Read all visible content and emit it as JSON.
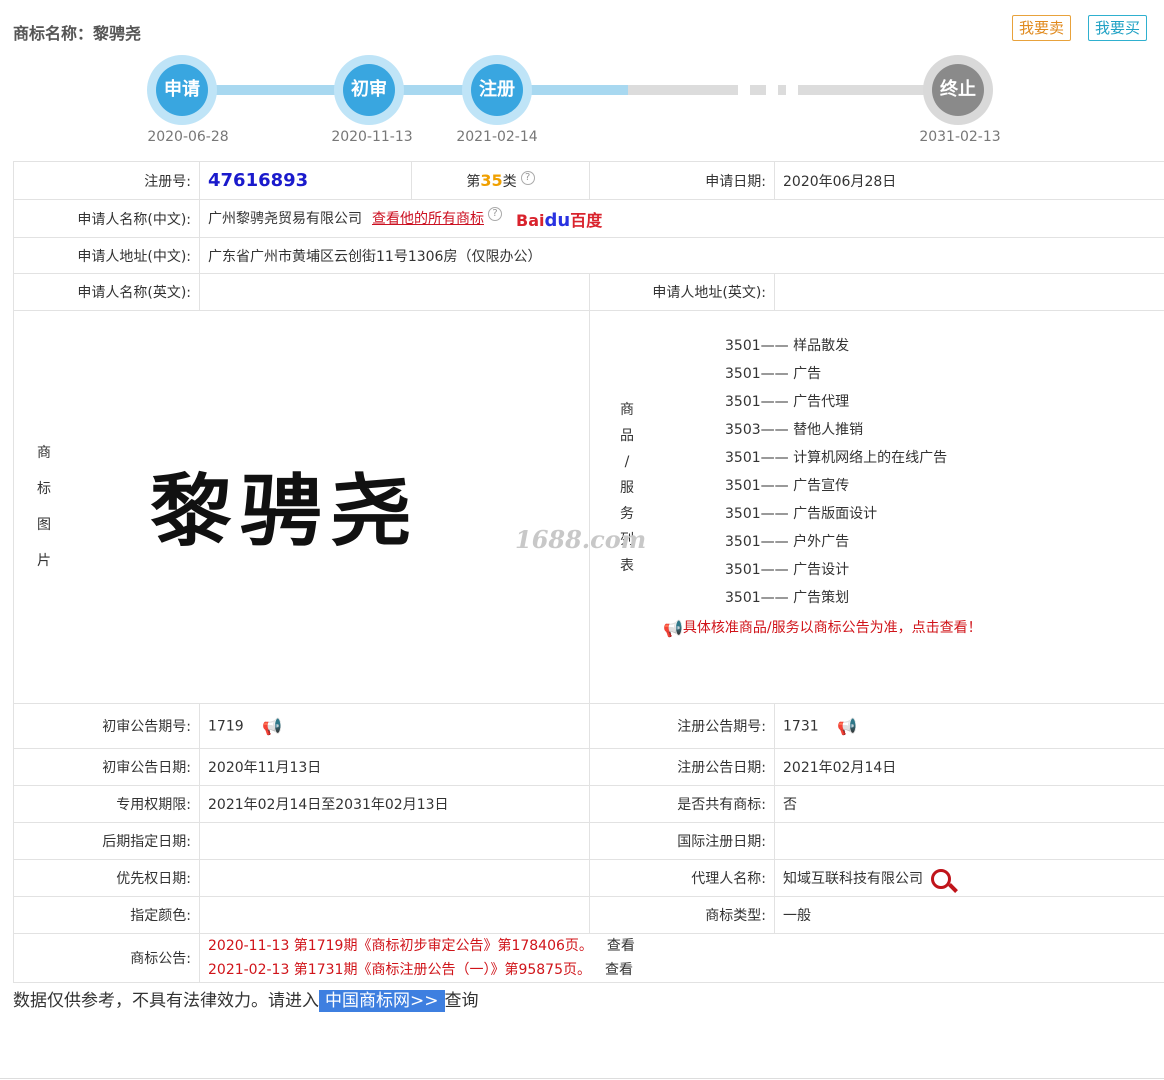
{
  "header": {
    "title_label": "商标名称：",
    "title_value": "黎骋尧",
    "sell_btn": "我要卖",
    "buy_btn": "我要买"
  },
  "timeline": [
    {
      "label": "申请",
      "date": "2020-06-28",
      "color": "#39a6e0"
    },
    {
      "label": "初审",
      "date": "2020-11-13",
      "color": "#39a6e0"
    },
    {
      "label": "注册",
      "date": "2021-02-14",
      "color": "#39a6e0"
    },
    {
      "label": "终止",
      "date": "2031-02-13",
      "color": "#8a8a8a"
    }
  ],
  "info": {
    "reg_no_label": "注册号:",
    "reg_no": "47616893",
    "class_prefix": "第",
    "class_num": "35",
    "class_suffix": "类",
    "apply_date_label": "申请日期:",
    "apply_date": "2020年06月28日",
    "applicant_cn_label": "申请人名称(中文):",
    "applicant_cn": "广州黎骋尧贸易有限公司",
    "all_marks_link": "查看他的所有商标",
    "baidu_text1": "Bai",
    "baidu_paw": "du",
    "baidu_text2": "百度",
    "address_cn_label": "申请人地址(中文):",
    "address_cn": "广东省广州市黄埔区云创街11号1306房（仅限办公）",
    "applicant_en_label": "申请人名称(英文):",
    "applicant_en": "",
    "address_en_label": "申请人地址(英文):",
    "address_en": "",
    "image_label_chars": [
      "商",
      "标",
      "图",
      "片"
    ],
    "mark_text": "黎骋尧",
    "watermark": "1688.com",
    "service_label_chars": [
      "商",
      "品",
      "/",
      "服",
      "务",
      "列",
      "表"
    ],
    "services": [
      {
        "code": "3501",
        "name": "样品散发"
      },
      {
        "code": "3501",
        "name": "广告"
      },
      {
        "code": "3501",
        "name": "广告代理"
      },
      {
        "code": "3503",
        "name": "替他人推销"
      },
      {
        "code": "3501",
        "name": "计算机网络上的在线广告"
      },
      {
        "code": "3501",
        "name": "广告宣传"
      },
      {
        "code": "3501",
        "name": "广告版面设计"
      },
      {
        "code": "3501",
        "name": "户外广告"
      },
      {
        "code": "3501",
        "name": "广告设计"
      },
      {
        "code": "3501",
        "name": "广告策划"
      }
    ],
    "service_notice": "具体核准商品/服务以商标公告为准，点击查看！",
    "prelim_issue_label": "初审公告期号:",
    "prelim_issue": "1719",
    "reg_issue_label": "注册公告期号:",
    "reg_issue": "1731",
    "prelim_date_label": "初审公告日期:",
    "prelim_date": "2020年11月13日",
    "reg_date_label": "注册公告日期:",
    "reg_date": "2021年02月14日",
    "exclusive_label": "专用权期限:",
    "exclusive": "2021年02月14日至2031年02月13日",
    "shared_label": "是否共有商标:",
    "shared": "否",
    "later_label": "后期指定日期:",
    "later": "",
    "intl_label": "国际注册日期:",
    "intl": "",
    "priority_label": "优先权日期:",
    "priority": "",
    "agent_label": "代理人名称:",
    "agent": "知域互联科技有限公司",
    "color_label": "指定颜色:",
    "color": "",
    "type_label": "商标类型:",
    "type": "一般",
    "notice_label": "商标公告:",
    "notices": [
      {
        "text": "2020-11-13 第1719期《商标初步审定公告》第178406页。",
        "link": "查看"
      },
      {
        "text": "2021-02-13 第1731期《商标注册公告（一）》第95875页。",
        "link": "查看"
      }
    ]
  },
  "footer": {
    "text1": "数据仅供参考，不具有法律效力。请进入",
    "cta": "中国商标网>>",
    "text2": "查询"
  }
}
